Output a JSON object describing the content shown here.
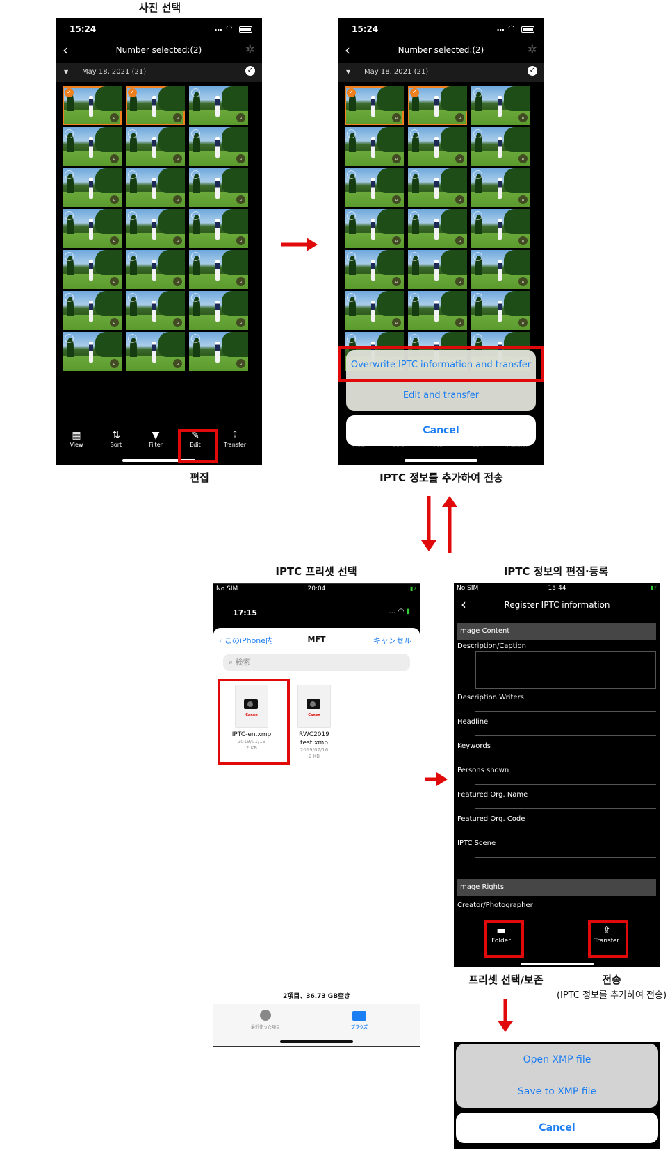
{
  "captions": {
    "select_photos": "사진 선택",
    "edit": "편집",
    "add_iptc_transfer": "IPTC 정보를 추가하여 전송",
    "select_preset": "IPTC 프리셋 선택",
    "edit_register": "IPTC 정보의 편집·등록",
    "preset_select_save": "프리셋 선택/보존",
    "transfer": "전송",
    "transfer_sub": "(IPTC 정보를 추가하여 전송)"
  },
  "gallery": {
    "status_time": "15:24",
    "signal": "....",
    "title": "Number selected:(2)",
    "date_header": "May 18, 2021 (21)",
    "selected_indices": [
      0,
      1
    ],
    "thumbnail_count": 21,
    "toolbar": [
      {
        "icon": "grid-icon",
        "glyph": "▦",
        "label": "View"
      },
      {
        "icon": "sort-icon",
        "glyph": "⇅",
        "label": "Sort"
      },
      {
        "icon": "filter-icon",
        "glyph": "▼",
        "label": "Filter"
      },
      {
        "icon": "edit-icon",
        "glyph": "✎",
        "label": "Edit"
      },
      {
        "icon": "transfer-icon",
        "glyph": "⇪",
        "label": "Transfer"
      }
    ]
  },
  "action_sheet": {
    "overwrite": "Overwrite IPTC information and transfer",
    "edit_transfer": "Edit and transfer",
    "cancel": "Cancel"
  },
  "picker": {
    "outer_status_left": "No SIM",
    "outer_status_time": "20:04",
    "inner_time": "17:15",
    "back_label": "このiPhone内",
    "title": "MFT",
    "cancel_label": "キャンセル",
    "search_placeholder": "検索",
    "files": [
      {
        "name": "IPTC-en.xmp",
        "date": "2019/01/19",
        "size": "2 KB",
        "brand": "Canon"
      },
      {
        "name": "RWC2019 test.xmp",
        "date": "2019/07/16",
        "size": "2 KB",
        "brand": "Canon"
      }
    ],
    "footer": "2項目、36.73 GB空き",
    "tabs": [
      {
        "label": "最近使った項目",
        "icon": "clock-icon"
      },
      {
        "label": "ブラウズ",
        "icon": "folder-icon"
      }
    ]
  },
  "register": {
    "status_left": "No SIM",
    "status_time": "15:44",
    "title": "Register IPTC information",
    "section_content": "Image Content",
    "fields": [
      "Description/Caption",
      "Description Writers",
      "Headline",
      "Keywords",
      "Persons shown",
      "Featured Org. Name",
      "Featured Org. Code",
      "IPTC Scene"
    ],
    "section_rights": "Image Rights",
    "rights_fields": [
      "Creator/Photographer"
    ],
    "folder_label": "Folder",
    "transfer_label": "Transfer"
  },
  "xmp_sheet": {
    "open": "Open XMP file",
    "save": "Save to XMP file",
    "cancel": "Cancel"
  },
  "colors": {
    "accent_red": "#e00a0a",
    "ios_blue": "#1b7ef2",
    "selection_orange": "#f07f1e"
  }
}
